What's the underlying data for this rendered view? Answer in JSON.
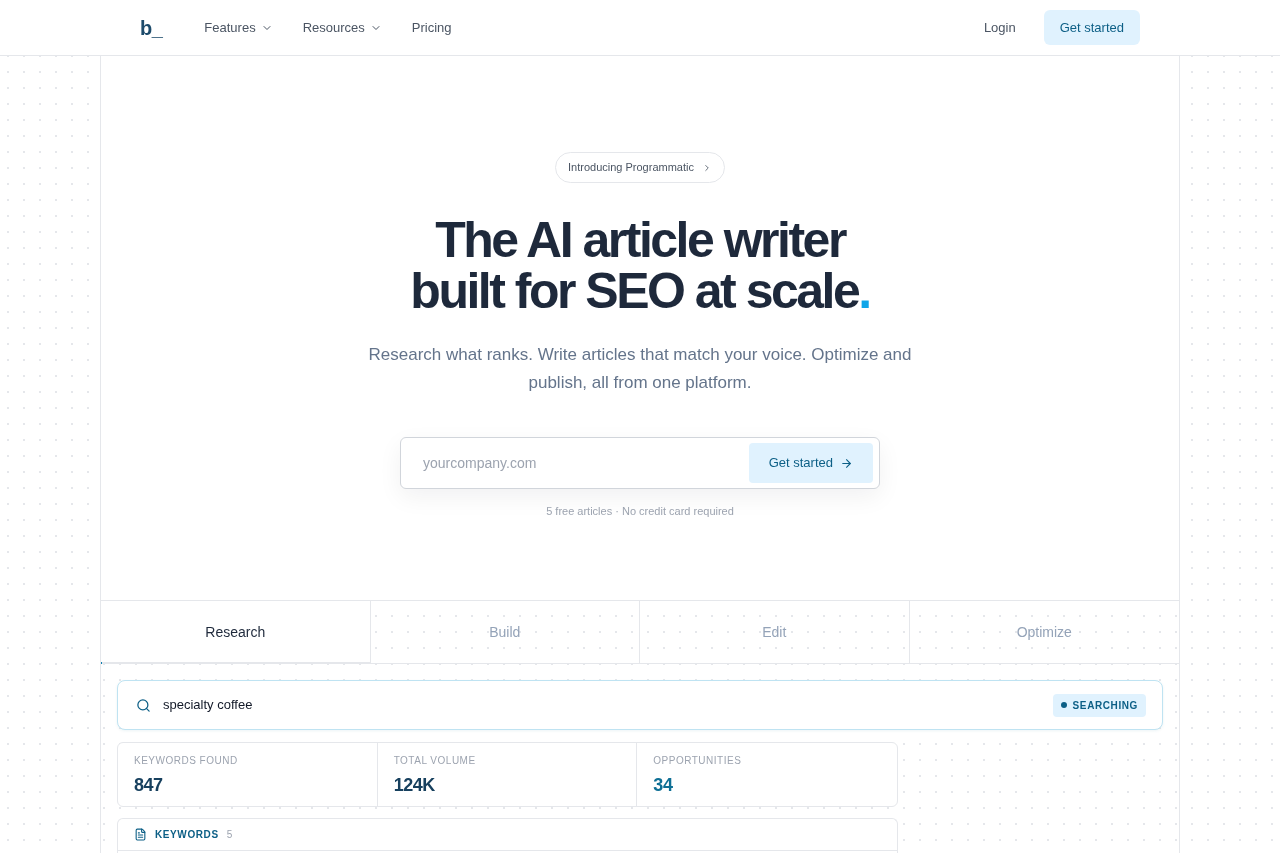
{
  "nav": {
    "logo": "b_",
    "links": [
      {
        "label": "Features",
        "dropdown": true
      },
      {
        "label": "Resources",
        "dropdown": true
      },
      {
        "label": "Pricing",
        "dropdown": false
      }
    ],
    "login": "Login",
    "cta": "Get started"
  },
  "hero": {
    "announcement": "Introducing Programmatic",
    "headline": {
      "lines": [
        "The AI article writer",
        "built for SEO at scale"
      ],
      "accent": "."
    },
    "subtitle": "Research what ranks. Write articles that match your voice. Optimize and publish, all from one platform.",
    "signup": {
      "placeholder": "yourcompany.com",
      "button": "Get started"
    },
    "note": "5 free articles · No credit card required"
  },
  "tabs": {
    "items": [
      {
        "label": "Research",
        "selected": true
      },
      {
        "label": "Build",
        "selected": false
      },
      {
        "label": "Edit",
        "selected": false
      },
      {
        "label": "Optimize",
        "selected": false
      }
    ],
    "progress": {
      "level": 0.005
    }
  },
  "research": {
    "search": {
      "value": "specialty coffee",
      "status": "SEARCHING"
    },
    "stats": [
      {
        "label": "KEYWORDS FOUND",
        "value": "847",
        "highlight": false
      },
      {
        "label": "TOTAL VOLUME",
        "value": "124K",
        "highlight": false
      },
      {
        "label": "OPPORTUNITIES",
        "value": "34",
        "highlight": true
      }
    ],
    "keywords": {
      "title": "KEYWORDS",
      "count": "5"
    }
  }
}
